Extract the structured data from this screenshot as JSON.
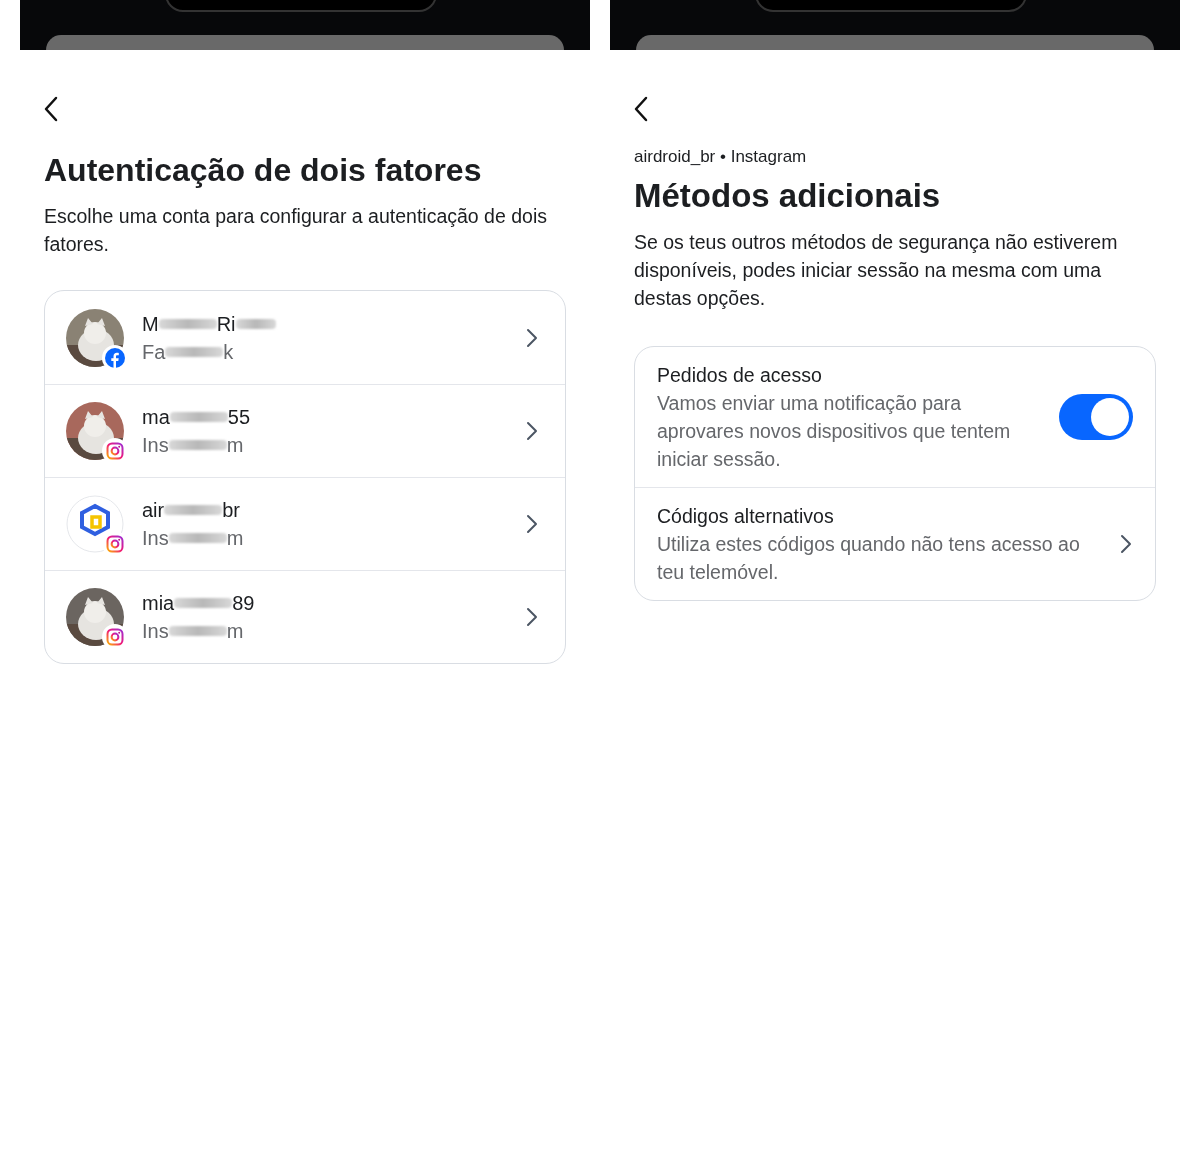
{
  "screens": [
    {
      "title": "Autenticação de dois fatores",
      "subtitle": "Escolhe uma conta para configurar a autenticação de dois fatores.",
      "accounts": [
        {
          "name": [
            "M",
            "Ri"
          ],
          "name_trailing_blur": true,
          "network": [
            "Fa",
            "k"
          ],
          "badge": {
            "kind": "facebook"
          }
        },
        {
          "name": [
            "ma",
            "55"
          ],
          "name_trailing_blur": false,
          "network": [
            "Ins",
            "m"
          ],
          "badge": {
            "kind": "instagram"
          }
        },
        {
          "name": [
            "air",
            "br"
          ],
          "name_trailing_blur": false,
          "network": [
            "Ins",
            "m"
          ],
          "badge": {
            "kind": "instagram"
          },
          "avatar": {
            "kind": "logo"
          }
        },
        {
          "name": [
            "mia",
            "89"
          ],
          "name_trailing_blur": false,
          "network": [
            "Ins",
            "m"
          ],
          "badge": {
            "kind": "instagram"
          }
        }
      ]
    },
    {
      "context": "airdroid_br • Instagram",
      "title": "Métodos adicionais",
      "subtitle": "Se os teus outros métodos de segurança não estiverem disponíveis, podes iniciar sessão na mesma com uma destas opções.",
      "methods": [
        {
          "kind": "toggle",
          "title": "Pedidos de acesso",
          "description": "Vamos enviar uma notificação para aprovares novos dispositivos que tentem iniciar sessão.",
          "on": true
        },
        {
          "kind": "link",
          "title": "Códigos alternativos",
          "description": "Utiliza estes códigos quando não tens acesso ao teu telemóvel."
        }
      ]
    }
  ]
}
